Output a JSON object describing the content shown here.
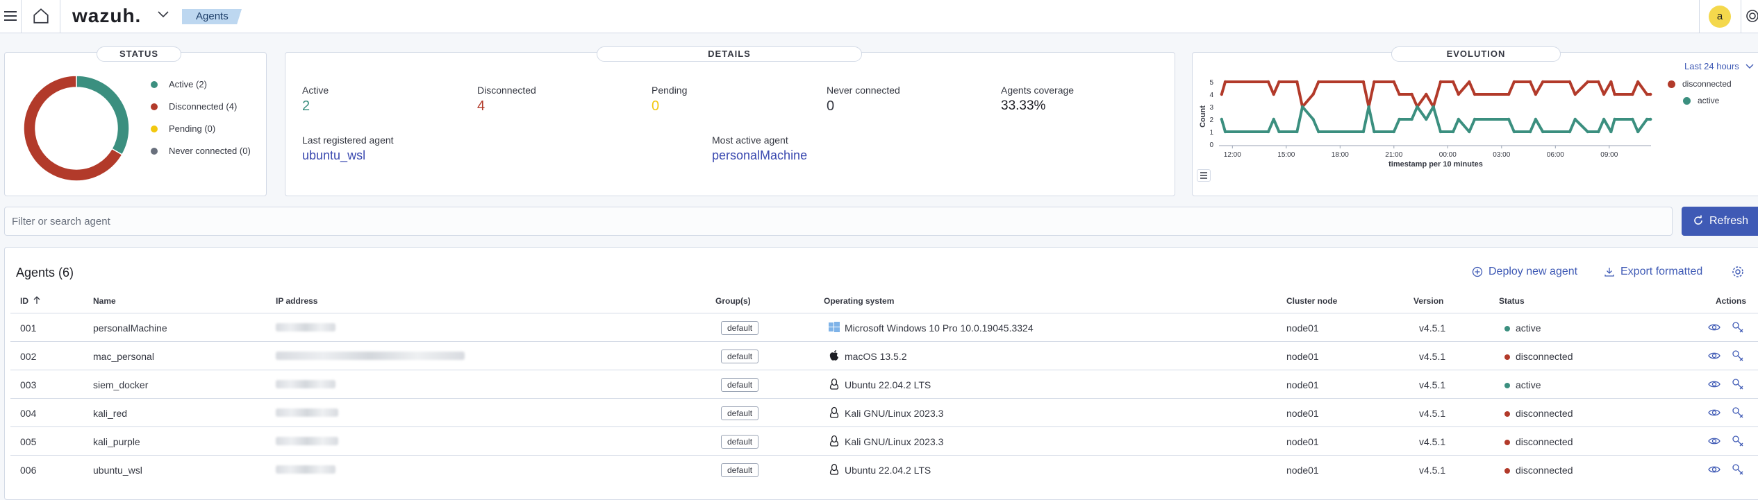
{
  "app": {
    "logo": "wazuh.",
    "breadcrumb": "Agents",
    "user_initial": "a"
  },
  "status": {
    "title": "STATUS",
    "legend": [
      {
        "label": "Active (2)",
        "color": "#3b8f7f",
        "value": 2
      },
      {
        "label": "Disconnected (4)",
        "color": "#b23a2a",
        "value": 4
      },
      {
        "label": "Pending (0)",
        "color": "#f2c80f",
        "value": 0
      },
      {
        "label": "Never connected (0)",
        "color": "#69707d",
        "value": 0
      }
    ]
  },
  "details": {
    "title": "DETAILS",
    "active_label": "Active",
    "active_value": "2",
    "disconnected_label": "Disconnected",
    "disconnected_value": "4",
    "pending_label": "Pending",
    "pending_value": "0",
    "never_label": "Never connected",
    "never_value": "0",
    "coverage_label": "Agents coverage",
    "coverage_value": "33.33%",
    "last_registered_label": "Last registered agent",
    "last_registered_value": "ubuntu_wsl",
    "most_active_label": "Most active agent",
    "most_active_value": "personalMachine"
  },
  "evolution": {
    "title": "EVOLUTION",
    "range": "Last 24 hours",
    "legend": [
      {
        "label": "disconnected",
        "color": "#b23a2a"
      },
      {
        "label": "active",
        "color": "#3b8f7f"
      }
    ]
  },
  "chart_data": {
    "type": "line",
    "xlabel": "timestamp per 10 minutes",
    "ylabel": "Count",
    "ylim": [
      0,
      5
    ],
    "y_ticks": [
      "5",
      "4",
      "3",
      "2",
      "1",
      "0"
    ],
    "x_ticks": [
      "12:00",
      "15:00",
      "18:00",
      "21:00",
      "00:00",
      "03:00",
      "06:00",
      "09:00"
    ],
    "x_tick_hours": [
      12,
      15,
      18,
      21,
      24,
      27,
      30,
      33
    ],
    "x_range_hours": [
      11.33,
      35.33
    ],
    "series": [
      {
        "name": "disconnected",
        "color": "#b23a2a",
        "points": [
          [
            11.4,
            4
          ],
          [
            11.6,
            5
          ],
          [
            14.0,
            5
          ],
          [
            14.3,
            4
          ],
          [
            14.6,
            5
          ],
          [
            15.6,
            5
          ],
          [
            15.9,
            3
          ],
          [
            16.5,
            4
          ],
          [
            16.8,
            5
          ],
          [
            19.3,
            5
          ],
          [
            19.6,
            3
          ],
          [
            19.9,
            5
          ],
          [
            21.0,
            5
          ],
          [
            21.3,
            4
          ],
          [
            22.0,
            4
          ],
          [
            22.3,
            3
          ],
          [
            22.8,
            4
          ],
          [
            23.2,
            3
          ],
          [
            23.6,
            5
          ],
          [
            24.3,
            5
          ],
          [
            24.6,
            4
          ],
          [
            25.2,
            5
          ],
          [
            25.5,
            4
          ],
          [
            27.4,
            4
          ],
          [
            27.7,
            5
          ],
          [
            28.6,
            5
          ],
          [
            28.9,
            4
          ],
          [
            29.3,
            5
          ],
          [
            30.8,
            5
          ],
          [
            31.1,
            4
          ],
          [
            31.8,
            5
          ],
          [
            32.4,
            5
          ],
          [
            32.7,
            4
          ],
          [
            33.1,
            5
          ],
          [
            33.3,
            4
          ],
          [
            34.3,
            4
          ],
          [
            34.6,
            5
          ],
          [
            35.1,
            4
          ],
          [
            35.3,
            4
          ]
        ]
      },
      {
        "name": "active",
        "color": "#3b8f7f",
        "points": [
          [
            11.4,
            2
          ],
          [
            11.6,
            1
          ],
          [
            14.0,
            1
          ],
          [
            14.3,
            2
          ],
          [
            14.6,
            1
          ],
          [
            15.6,
            1
          ],
          [
            15.9,
            3
          ],
          [
            16.5,
            2
          ],
          [
            16.8,
            1
          ],
          [
            19.3,
            1
          ],
          [
            19.6,
            3
          ],
          [
            19.9,
            1
          ],
          [
            21.0,
            1
          ],
          [
            21.3,
            2
          ],
          [
            22.0,
            2
          ],
          [
            22.3,
            3
          ],
          [
            22.8,
            2
          ],
          [
            23.2,
            3
          ],
          [
            23.6,
            1
          ],
          [
            24.3,
            1
          ],
          [
            24.6,
            2
          ],
          [
            25.2,
            1
          ],
          [
            25.5,
            2
          ],
          [
            27.4,
            2
          ],
          [
            27.7,
            1
          ],
          [
            28.6,
            1
          ],
          [
            28.9,
            2
          ],
          [
            29.3,
            1
          ],
          [
            30.8,
            1
          ],
          [
            31.1,
            2
          ],
          [
            31.8,
            1
          ],
          [
            32.4,
            1
          ],
          [
            32.7,
            2
          ],
          [
            33.1,
            1
          ],
          [
            33.3,
            2
          ],
          [
            34.3,
            2
          ],
          [
            34.6,
            1
          ],
          [
            35.1,
            2
          ],
          [
            35.3,
            2
          ]
        ]
      }
    ]
  },
  "search": {
    "placeholder": "Filter or search agent"
  },
  "refresh_label": "Refresh",
  "table": {
    "title": "Agents (6)",
    "deploy_label": "Deploy new agent",
    "export_label": "Export formatted",
    "headers": {
      "id": "ID",
      "name": "Name",
      "ip": "IP address",
      "groups": "Group(s)",
      "os": "Operating system",
      "node": "Cluster node",
      "version": "Version",
      "status": "Status",
      "actions": "Actions"
    },
    "rows": [
      {
        "id": "001",
        "name": "personalMachine",
        "group": "default",
        "os_icon": "windows-icon",
        "os": "Microsoft Windows 10 Pro 10.0.19045.3324",
        "node": "node01",
        "version": "v4.5.1",
        "status": "active",
        "status_color": "#3b8f7f"
      },
      {
        "id": "002",
        "name": "mac_personal",
        "group": "default",
        "os_icon": "apple-icon",
        "os": "macOS 13.5.2",
        "node": "node01",
        "version": "v4.5.1",
        "status": "disconnected",
        "status_color": "#b23a2a"
      },
      {
        "id": "003",
        "name": "siem_docker",
        "group": "default",
        "os_icon": "linux-icon",
        "os": "Ubuntu 22.04.2 LTS",
        "node": "node01",
        "version": "v4.5.1",
        "status": "active",
        "status_color": "#3b8f7f"
      },
      {
        "id": "004",
        "name": "kali_red",
        "group": "default",
        "os_icon": "linux-icon",
        "os": "Kali GNU/Linux 2023.3",
        "node": "node01",
        "version": "v4.5.1",
        "status": "disconnected",
        "status_color": "#b23a2a"
      },
      {
        "id": "005",
        "name": "kali_purple",
        "group": "default",
        "os_icon": "linux-icon",
        "os": "Kali GNU/Linux 2023.3",
        "node": "node01",
        "version": "v4.5.1",
        "status": "disconnected",
        "status_color": "#b23a2a"
      },
      {
        "id": "006",
        "name": "ubuntu_wsl",
        "group": "default",
        "os_icon": "linux-icon",
        "os": "Ubuntu 22.04.2 LTS",
        "node": "node01",
        "version": "v4.5.1",
        "status": "disconnected",
        "status_color": "#b23a2a"
      }
    ]
  }
}
